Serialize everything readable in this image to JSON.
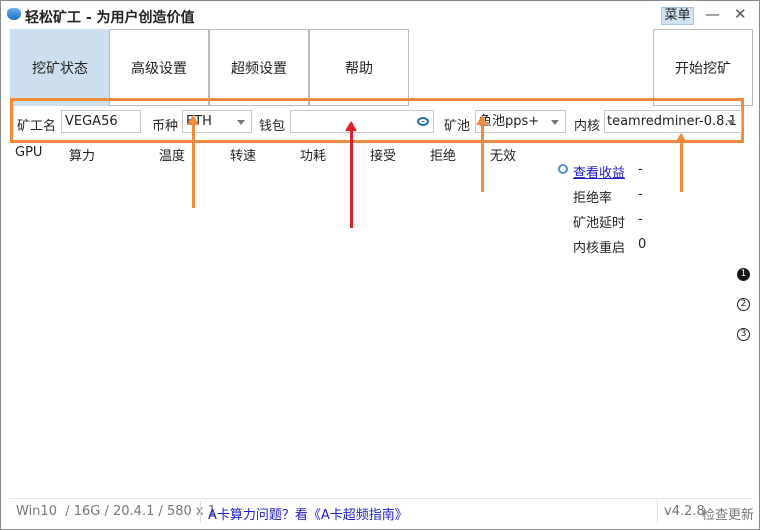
{
  "window": {
    "title": "轻松矿工 - 为用户创造价值",
    "menu_label": "菜单",
    "minimize": "—",
    "close": "✕"
  },
  "tabs": [
    {
      "label": "挖矿状态"
    },
    {
      "label": "高级设置"
    },
    {
      "label": "超频设置"
    },
    {
      "label": "帮助"
    }
  ],
  "start_button": "开始挖矿",
  "form": {
    "miner_name_label": "矿工名",
    "miner_name_value": "VEGA56",
    "coin_label": "币种",
    "coin_value": "ETH",
    "wallet_label": "钱包",
    "wallet_value": "",
    "pool_label": "矿池",
    "pool_value": "鱼池pps+",
    "kernel_label": "内核",
    "kernel_value": "teamredminer-0.8.1"
  },
  "columns": [
    "GPU",
    "算力",
    "温度",
    "转速",
    "功耗",
    "接受",
    "拒绝",
    "无效"
  ],
  "stats": {
    "earnings_link": "查看收益",
    "earnings_value": "-",
    "reject_rate_label": "拒绝率",
    "reject_rate_value": "-",
    "pool_latency_label": "矿池延时",
    "pool_latency_value": "-",
    "kernel_restart_label": "内核重启",
    "kernel_restart_value": "0"
  },
  "pages": [
    "1",
    "2",
    "3"
  ],
  "footer": {
    "system_info": "Win10  / 16G / 20.4.1 / 580 x 1",
    "guide_link": "A卡算力问题？看《A卡超频指南》",
    "version": "v4.2.8",
    "update_link": "检查更新"
  },
  "colors": {
    "accent_orange": "#f08a3c",
    "accent_red": "#e0202a",
    "link_blue": "#1a1ad0",
    "tab_active": "#cddfef"
  }
}
